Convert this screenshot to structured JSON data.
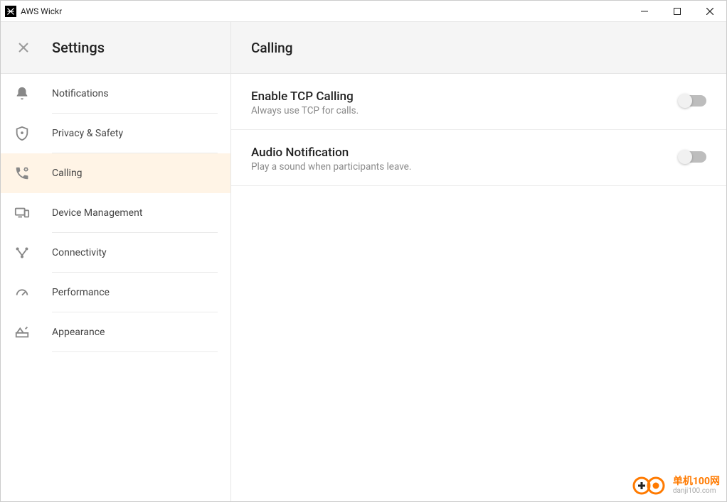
{
  "window": {
    "title": "AWS Wickr"
  },
  "sidebar": {
    "title": "Settings",
    "items": [
      {
        "label": "Notifications",
        "icon": "bell-icon",
        "active": false
      },
      {
        "label": "Privacy & Safety",
        "icon": "shield-icon",
        "active": false
      },
      {
        "label": "Calling",
        "icon": "phone-settings-icon",
        "active": true
      },
      {
        "label": "Device Management",
        "icon": "devices-icon",
        "active": false
      },
      {
        "label": "Connectivity",
        "icon": "hub-icon",
        "active": false
      },
      {
        "label": "Performance",
        "icon": "speedometer-icon",
        "active": false
      },
      {
        "label": "Appearance",
        "icon": "appearance-icon",
        "active": false
      }
    ]
  },
  "content": {
    "title": "Calling",
    "settings": [
      {
        "title": "Enable TCP Calling",
        "description": "Always use TCP for calls.",
        "value": false
      },
      {
        "title": "Audio Notification",
        "description": "Play a sound when participants leave.",
        "value": false
      }
    ]
  },
  "watermark": {
    "line1": "单机100网",
    "line2": "danji100.com"
  }
}
